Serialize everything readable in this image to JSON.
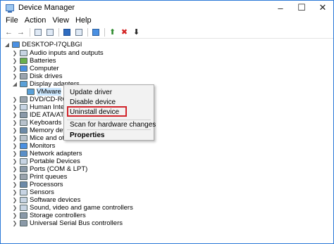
{
  "window": {
    "title": "Device Manager"
  },
  "menu": [
    "File",
    "Action",
    "View",
    "Help"
  ],
  "toolbar": {
    "icons": [
      "back-arrow-icon",
      "forward-arrow-icon",
      "properties-icon",
      "help-icon",
      "show-hidden-icon",
      "monitor-icon",
      "enable-device-icon",
      "remove-icon",
      "download-icon"
    ]
  },
  "tree": {
    "root": "DESKTOP-I7QLBGI",
    "items": [
      "Audio inputs and outputs",
      "Batteries",
      "Computer",
      "Disk drives",
      "Display adapters",
      "VMware",
      "DVD/CD-ROM",
      "Human Interf",
      "IDE ATA/ATAPI",
      "Keyboards",
      "Memory devi",
      "Mice and oth",
      "Monitors",
      "Network adapters",
      "Portable Devices",
      "Ports (COM & LPT)",
      "Print queues",
      "Processors",
      "Sensors",
      "Software devices",
      "Sound, video and game controllers",
      "Storage controllers",
      "Universal Serial Bus controllers"
    ]
  },
  "context_menu": {
    "items": [
      "Update driver",
      "Disable device",
      "Uninstall device",
      "Scan for hardware changes",
      "Properties"
    ],
    "highlighted": "Uninstall device"
  },
  "colors": {
    "accent": "#2b79d8",
    "highlight": "#d1232a"
  }
}
